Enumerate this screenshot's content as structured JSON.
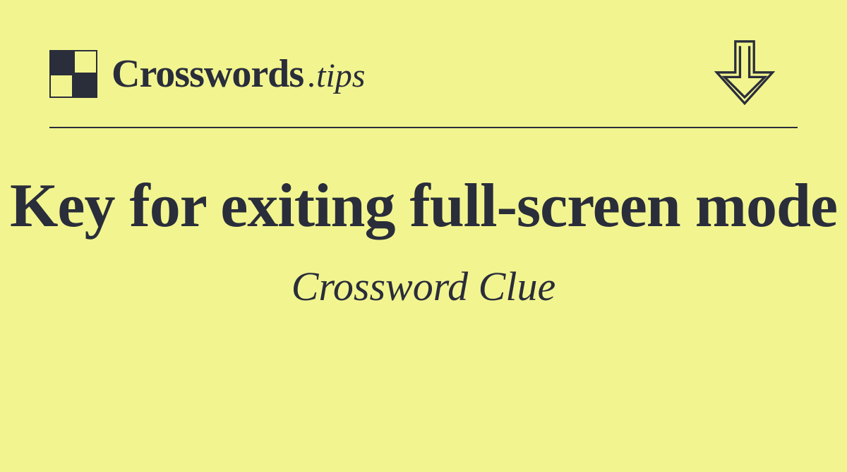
{
  "header": {
    "brand_name": "Crosswords",
    "brand_suffix": ".tips"
  },
  "main": {
    "clue": "Key for exiting full-screen mode",
    "subtitle": "Crossword Clue"
  },
  "colors": {
    "background": "#f2f58f",
    "text": "#2a2d3a"
  }
}
